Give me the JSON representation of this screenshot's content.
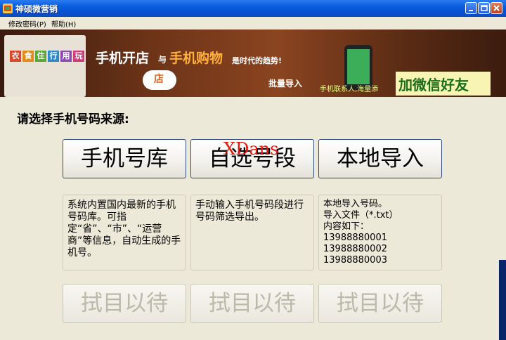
{
  "window": {
    "title": "神硕微营销"
  },
  "menu": {
    "items": [
      "修改密码(P)",
      "帮助(H)"
    ]
  },
  "banner": {
    "categories": [
      "衣",
      "食",
      "住",
      "行",
      "用",
      "玩"
    ],
    "slogan_a": "手机开店",
    "slogan_and": "与",
    "slogan_b": "手机购物",
    "slogan_c": "是时代的趋势!",
    "cloud_text": "店",
    "import_text": "批量导入",
    "contacts_text": "手机联系人,海量添",
    "add_friends": "加微信好友"
  },
  "main": {
    "prompt": "请选择手机号码来源:",
    "buttons": [
      "手机号库",
      "自选号段",
      "本地导入"
    ],
    "watermark": "XDans",
    "descriptions": [
      "系统内置国内最新的手机号码库。可指定“省”、“市”、“运营商”等信息，自动生成的手机号。",
      "手动输入手机号码段进行号码筛选导出。",
      "本地导入号码。\n导入文件（*.txt）\n内容如下：\n13988880001\n13988880002\n13988880003"
    ],
    "disabled_buttons": [
      "拭目以待",
      "拭目以待",
      "拭目以待"
    ]
  },
  "colors": {
    "titlebar": "#0a5fe0",
    "window_bg": "#ece9d8",
    "watermark": "#e8140a",
    "disabled_text": "#bcb9a8"
  }
}
